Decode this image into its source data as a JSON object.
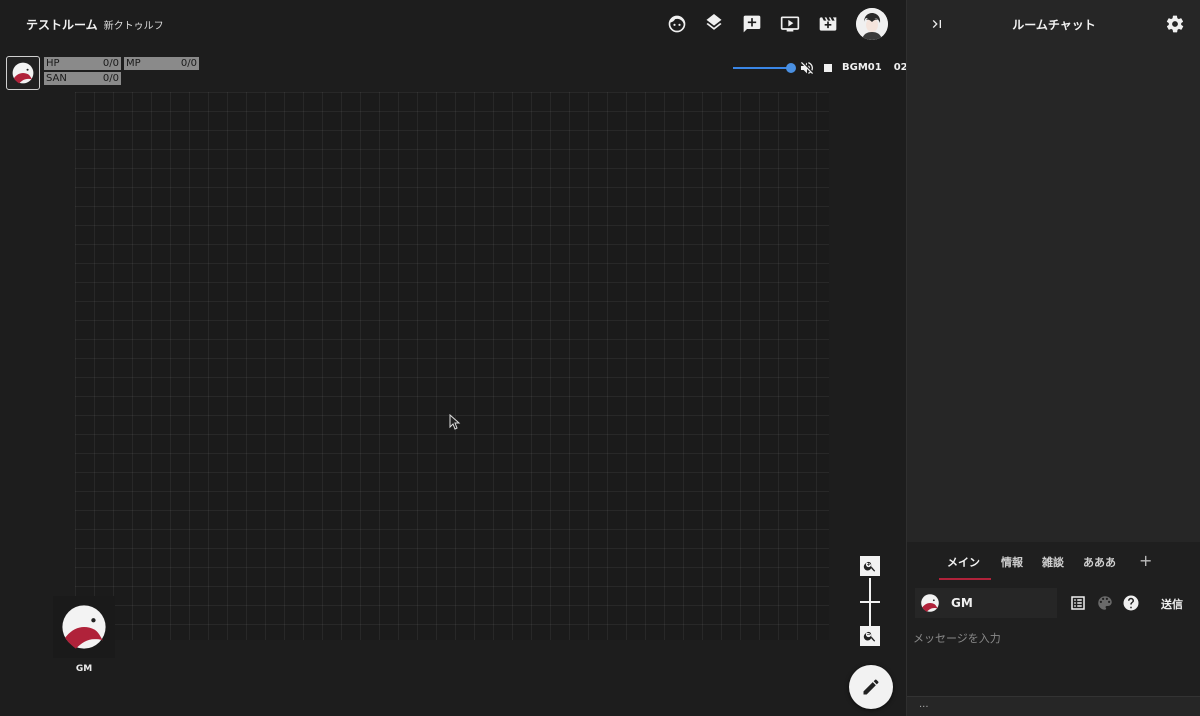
{
  "room": {
    "title": "テストルーム",
    "subtitle": "新クトゥルフ"
  },
  "toolbar": {
    "icons": [
      "face-icon",
      "layers-icon",
      "add-comment-icon",
      "screen-icon",
      "scene-icon"
    ]
  },
  "status": {
    "hp": {
      "label": "HP",
      "value": "0/0"
    },
    "mp": {
      "label": "MP",
      "value": "0/0"
    },
    "san": {
      "label": "SAN",
      "value": "0/0"
    }
  },
  "bgm": {
    "name": "BGM01",
    "track": "02",
    "volume": 1.0
  },
  "gm_token": {
    "label": "GM"
  },
  "chat": {
    "title": "ルームチャット",
    "tabs": [
      {
        "label": "メイン",
        "active": true
      },
      {
        "label": "情報",
        "active": false
      },
      {
        "label": "雑談",
        "active": false
      },
      {
        "label": "あああ",
        "active": false
      }
    ],
    "add_tab": "+",
    "sender": "GM",
    "send_label": "送信",
    "input_placeholder": "メッセージを入力",
    "typing_indicator": "..."
  },
  "colors": {
    "accent": "#b0223a",
    "volume": "#4a90e2",
    "background": "#1d1d1d"
  }
}
